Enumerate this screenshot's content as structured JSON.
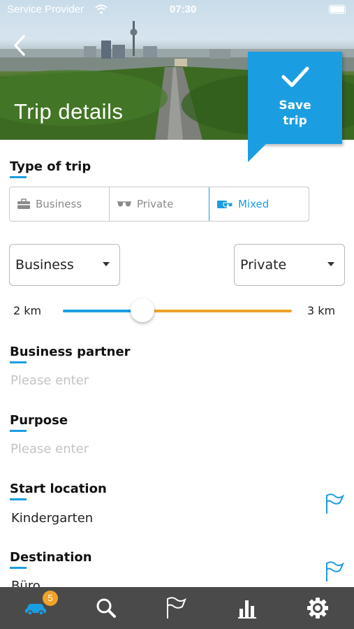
{
  "status_bar": {
    "carrier": "Service Provider",
    "time": "07:30"
  },
  "header": {
    "title": "Trip details",
    "save_label_line1": "Save",
    "save_label_line2": "trip"
  },
  "trip_type": {
    "heading": "Type of trip",
    "options": [
      {
        "label": "Business",
        "icon": "briefcase-icon"
      },
      {
        "label": "Private",
        "icon": "sunglasses-icon"
      },
      {
        "label": "Mixed",
        "icon": "mixed-icon"
      }
    ],
    "selected": "Mixed"
  },
  "split": {
    "left_select": "Business",
    "right_select": "Private",
    "left_value": "2 km",
    "right_value": "3 km",
    "slider_fraction": 0.4
  },
  "business_partner": {
    "heading": "Business partner",
    "placeholder": "Please enter"
  },
  "purpose": {
    "heading": "Purpose",
    "placeholder": "Please enter"
  },
  "start_location": {
    "heading": "Start location",
    "value": "Kindergarten"
  },
  "destination": {
    "heading": "Destination",
    "value": "Büro"
  },
  "tabbar": {
    "items": [
      "car-icon",
      "search-icon",
      "flag-icon",
      "chart-icon",
      "gear-icon"
    ],
    "badge": "5",
    "active": "car-icon"
  },
  "colors": {
    "accent": "#1b9de2",
    "orange": "#f0a22a",
    "tabbar": "#4a4a4a"
  }
}
